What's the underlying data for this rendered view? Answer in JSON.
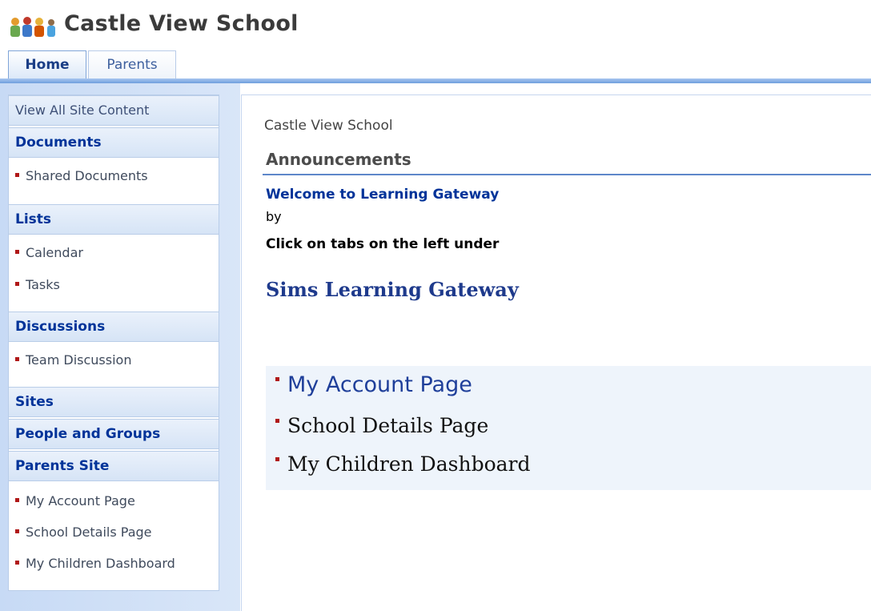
{
  "header": {
    "title": "Castle View School",
    "logo": "people-group-icon"
  },
  "tabs": [
    {
      "label": "Home",
      "active": true
    },
    {
      "label": "Parents",
      "active": false
    }
  ],
  "quicklaunch": {
    "view_all": "View All Site Content",
    "sections": [
      {
        "title": "Documents",
        "items": [
          "Shared Documents"
        ]
      },
      {
        "title": "Lists",
        "items": [
          "Calendar",
          "Tasks"
        ]
      },
      {
        "title": "Discussions",
        "items": [
          "Team Discussion"
        ]
      },
      {
        "title": "Sites",
        "items": []
      },
      {
        "title": "People and Groups",
        "items": []
      },
      {
        "title": "Parents Site",
        "items": [
          "My Account Page",
          "School Details Page",
          "My Children Dashboard"
        ]
      }
    ]
  },
  "main": {
    "page_title": "Castle View School",
    "announcements": {
      "title": "Announcements",
      "item_title": "Welcome to Learning Gateway",
      "by": "by",
      "body": "Click on tabs on the left under",
      "heading": "Sims Learning Gateway"
    },
    "links": [
      "My Account Page",
      "School Details Page",
      "My Children Dashboard"
    ]
  },
  "colors": {
    "accent": "#003399",
    "bullet": "#b01818",
    "nav_bg": "#d6e4f6"
  }
}
